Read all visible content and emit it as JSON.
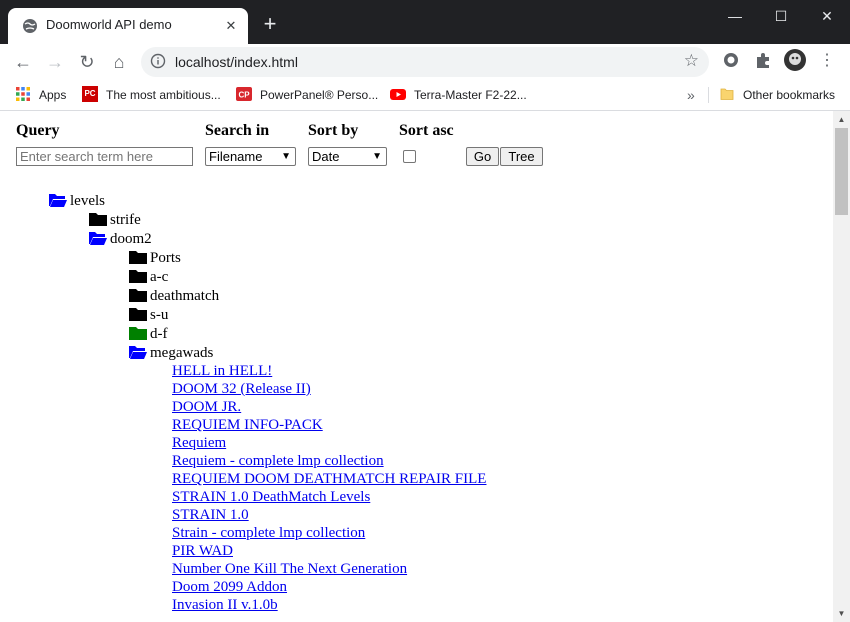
{
  "browser": {
    "tab_title": "Doomworld API demo",
    "new_tab_glyph": "+",
    "close_glyph": "✕",
    "window_controls": {
      "minimize": "—",
      "maximize": "☐",
      "close": "✕"
    },
    "nav": {
      "back": "←",
      "forward": "→",
      "reload": "↻",
      "home": "⌂"
    },
    "url": "localhost/index.html",
    "star_glyph": "☆",
    "bookmarks": [
      {
        "label": "Apps",
        "icon": "apps-grid-icon"
      },
      {
        "label": "The most ambitious...",
        "icon": "pcgamer-icon"
      },
      {
        "label": "PowerPanel® Perso...",
        "icon": "cp-icon"
      },
      {
        "label": "Terra-Master F2-22...",
        "icon": "youtube-icon"
      }
    ],
    "more_bookmarks_glyph": "»",
    "other_bookmarks": "Other bookmarks"
  },
  "form": {
    "query_label": "Query",
    "query_placeholder": "Enter search term here",
    "search_in_label": "Search in",
    "search_in_value": "Filename",
    "sort_by_label": "Sort by",
    "sort_by_value": "Date",
    "sort_asc_label": "Sort asc",
    "sort_asc_checked": false,
    "go_label": "Go",
    "tree_label": "Tree"
  },
  "tree": {
    "root": {
      "label": "levels",
      "open": true
    },
    "level1": [
      {
        "label": "strife",
        "open": false
      },
      {
        "label": "doom2",
        "open": true
      }
    ],
    "level2": [
      {
        "label": "Ports",
        "open": false,
        "color": "#000000"
      },
      {
        "label": "a-c",
        "open": false,
        "color": "#000000"
      },
      {
        "label": "deathmatch",
        "open": false,
        "color": "#000000"
      },
      {
        "label": "s-u",
        "open": false,
        "color": "#000000"
      },
      {
        "label": "d-f",
        "open": false,
        "color": "#008000"
      },
      {
        "label": "megawads",
        "open": true,
        "color": "#0000ff"
      }
    ],
    "files": [
      "HELL in HELL!",
      "DOOM 32 (Release II)",
      "DOOM JR.",
      "REQUIEM INFO-PACK",
      "Requiem",
      "Requiem - complete lmp collection",
      "REQUIEM DOOM DEATHMATCH REPAIR FILE",
      "STRAIN 1.0 DeathMatch Levels",
      "STRAIN 1.0",
      "Strain - complete lmp collection",
      "PIR WAD",
      "Number One Kill The Next Generation",
      "Doom 2099 Addon",
      "Invasion II v.1.0b"
    ]
  },
  "colors": {
    "open_folder": "#0000ff",
    "closed_folder": "#000000",
    "highlight_folder": "#008000",
    "link": "#0000ee"
  }
}
